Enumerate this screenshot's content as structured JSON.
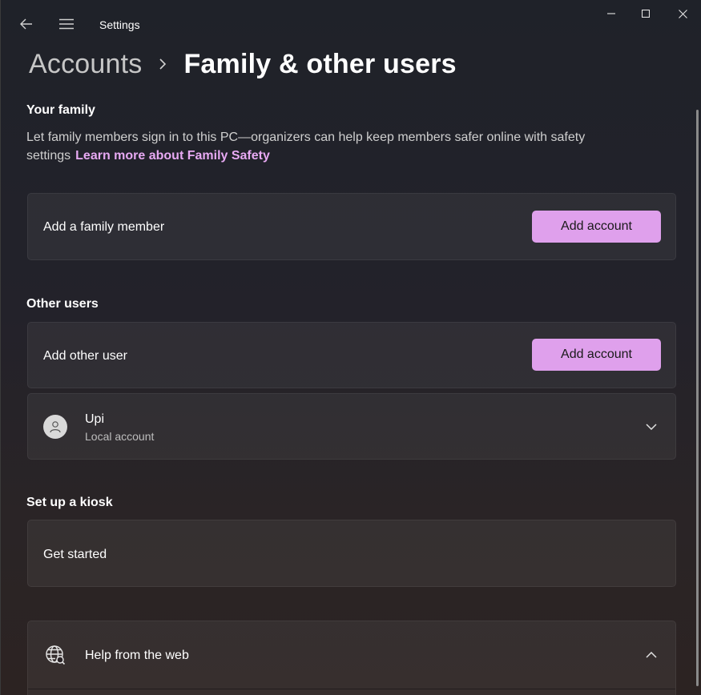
{
  "window": {
    "app_title": "Settings",
    "icons": {
      "back": "back-arrow-icon",
      "menu": "hamburger-menu-icon",
      "minimize": "minimize-icon",
      "maximize": "maximize-icon",
      "close": "close-icon"
    }
  },
  "breadcrumb": {
    "parent": "Accounts",
    "current": "Family & other users"
  },
  "family": {
    "title": "Your family",
    "description": "Let family members sign in to this PC—organizers can help keep members safer online with safety settings",
    "link": "Learn more about Family Safety",
    "card_label": "Add a family member",
    "button_label": "Add account"
  },
  "other_users": {
    "title": "Other users",
    "card_label": "Add other user",
    "button_label": "Add account",
    "users": [
      {
        "name": "Upi",
        "type": "Local account"
      }
    ]
  },
  "kiosk": {
    "title": "Set up a kiosk",
    "card_label": "Get started"
  },
  "help": {
    "label": "Help from the web"
  },
  "colors": {
    "accent": "#dfa0ec",
    "link": "#e7a9f3"
  }
}
